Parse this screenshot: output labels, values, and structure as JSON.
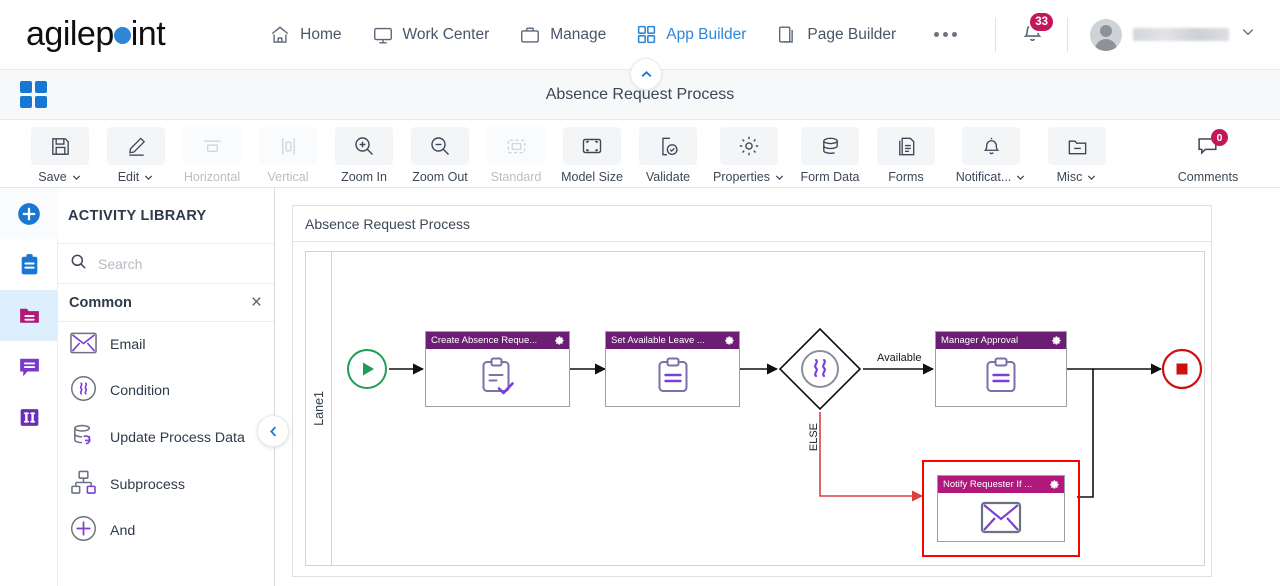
{
  "brand": {
    "name_part1": "agilep",
    "name_part2": "int",
    "accent": "#2f86d6"
  },
  "topnav": {
    "items": [
      {
        "label": "Home",
        "icon": "home-icon",
        "active": false
      },
      {
        "label": "Work Center",
        "icon": "monitor-icon",
        "active": false
      },
      {
        "label": "Manage",
        "icon": "briefcase-icon",
        "active": false
      },
      {
        "label": "App Builder",
        "icon": "grid-icon",
        "active": true
      },
      {
        "label": "Page Builder",
        "icon": "pages-icon",
        "active": false
      }
    ],
    "more_label": "",
    "notification_count": "33",
    "notification_color": "#c2185b",
    "username": ""
  },
  "titlebar": {
    "title": "Absence Request Process"
  },
  "toolbar": {
    "buttons": [
      {
        "label": "Save",
        "icon": "save-icon",
        "caret": true,
        "disabled": false
      },
      {
        "label": "Edit",
        "icon": "pencil-icon",
        "caret": true,
        "disabled": false
      },
      {
        "label": "Horizontal",
        "icon": "horizontal-align-icon",
        "caret": false,
        "disabled": true
      },
      {
        "label": "Vertical",
        "icon": "vertical-align-icon",
        "caret": false,
        "disabled": true
      },
      {
        "label": "Zoom In",
        "icon": "zoom-in-icon",
        "caret": false,
        "disabled": false
      },
      {
        "label": "Zoom Out",
        "icon": "zoom-out-icon",
        "caret": false,
        "disabled": false
      },
      {
        "label": "Standard",
        "icon": "standard-size-icon",
        "caret": false,
        "disabled": true
      },
      {
        "label": "Model Size",
        "icon": "model-size-icon",
        "caret": false,
        "disabled": false
      },
      {
        "label": "Validate",
        "icon": "validate-icon",
        "caret": false,
        "disabled": false
      },
      {
        "label": "Properties",
        "icon": "gear-icon",
        "caret": true,
        "disabled": false
      },
      {
        "label": "Form Data",
        "icon": "database-icon",
        "caret": false,
        "disabled": false
      },
      {
        "label": "Forms",
        "icon": "document-icon",
        "caret": false,
        "disabled": false
      },
      {
        "label": "Notificat...",
        "icon": "bell-icon",
        "caret": true,
        "disabled": false
      },
      {
        "label": "Misc",
        "icon": "folder-icon",
        "caret": true,
        "disabled": false
      }
    ],
    "comments": {
      "label": "Comments",
      "icon": "comment-icon",
      "count": "0"
    }
  },
  "rail": {
    "items": [
      {
        "name": "add-icon",
        "color": "#1877d2",
        "active": false
      },
      {
        "name": "clipboard-icon",
        "color": "#1877d2",
        "active": false
      },
      {
        "name": "folder-icon",
        "color": "#b0197b",
        "active": true
      },
      {
        "name": "comment-icon",
        "color": "#7b39c9",
        "active": false
      },
      {
        "name": "columns-icon",
        "color": "#6a2fb5",
        "active": false
      }
    ]
  },
  "activity_library": {
    "title": "ACTIVITY LIBRARY",
    "search": {
      "placeholder": "Search",
      "value": ""
    },
    "group": {
      "name": "Common",
      "close_label": "×"
    },
    "items": [
      {
        "label": "Email",
        "icon": "envelope-icon"
      },
      {
        "label": "Condition",
        "icon": "condition-icon"
      },
      {
        "label": "Update Process Data",
        "icon": "update-data-icon"
      },
      {
        "label": "Subprocess",
        "icon": "subprocess-icon"
      },
      {
        "label": "And",
        "icon": "and-icon"
      }
    ]
  },
  "canvas": {
    "model_title": "Absence Request Process",
    "lane_label": "Lane1",
    "node_header_color": "#6b1e74",
    "selected_header_color": "#b0197b",
    "selection_color": "#ff0000",
    "start_event": {
      "name": "start-event",
      "color": "#1f9d55"
    },
    "end_event": {
      "name": "end-event",
      "color": "#cc1111"
    },
    "nodes": [
      {
        "id": "create-absence-request",
        "title": "Create Absence Reque...",
        "icon": "form-check-icon",
        "selected": false
      },
      {
        "id": "set-available-leave",
        "title": "Set Available Leave ...",
        "icon": "form-icon",
        "selected": false
      },
      {
        "id": "manager-approval",
        "title": "Manager Approval",
        "icon": "form-icon",
        "selected": false
      },
      {
        "id": "notify-requester",
        "title": "Notify Requester If ...",
        "icon": "envelope-icon",
        "selected": true
      }
    ],
    "gateway": {
      "id": "condition-gateway",
      "icon": "condition-icon"
    },
    "edge_labels": [
      {
        "text": "Available",
        "orientation": "horizontal"
      },
      {
        "text": "ELSE",
        "orientation": "vertical"
      }
    ]
  }
}
